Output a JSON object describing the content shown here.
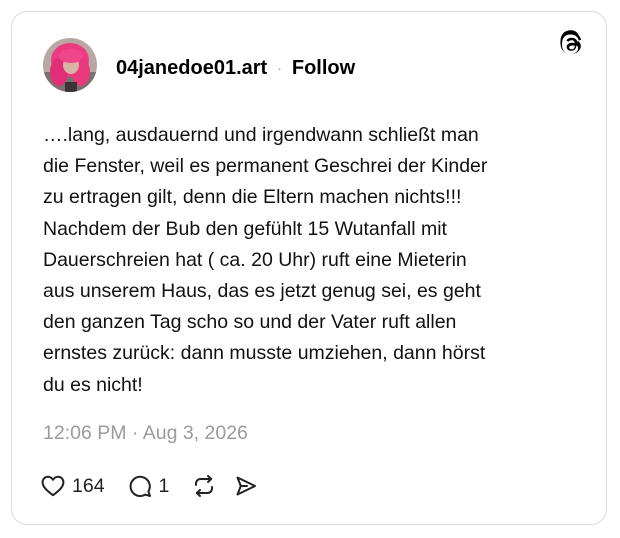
{
  "post": {
    "username": "04janedoe01.art",
    "separator": "·",
    "follow_label": "Follow",
    "text": "….lang, ausdauernd und irgendwann schließt man\ndie Fenster, weil es permanent Geschrei der Kinder\nzu ertragen gilt, denn die Eltern machen nichts!!!\nNachdem der Bub den gefühlt 15 Wutanfall mit\nDauerschreien hat ( ca. 20 Uhr) ruft eine Mieterin\naus unserem Haus, das  es jetzt genug sei, es geht\nden ganzen Tag scho so und der Vater ruft allen\nernstes zurück: dann musste umziehen, dann hörst\ndu es nicht!",
    "timestamp": "12:06 PM · Aug 3, 2026"
  },
  "actions": {
    "likes": "164",
    "replies": "1"
  },
  "icons": {
    "brand": "threads-logo-icon",
    "like": "heart-icon",
    "reply": "comment-bubble-icon",
    "repost": "repost-icon",
    "share": "send-icon"
  },
  "colors": {
    "text": "#111111",
    "muted": "#9b9b9b",
    "border": "#dcdcdc",
    "avatar_hair": "#e8347a"
  }
}
